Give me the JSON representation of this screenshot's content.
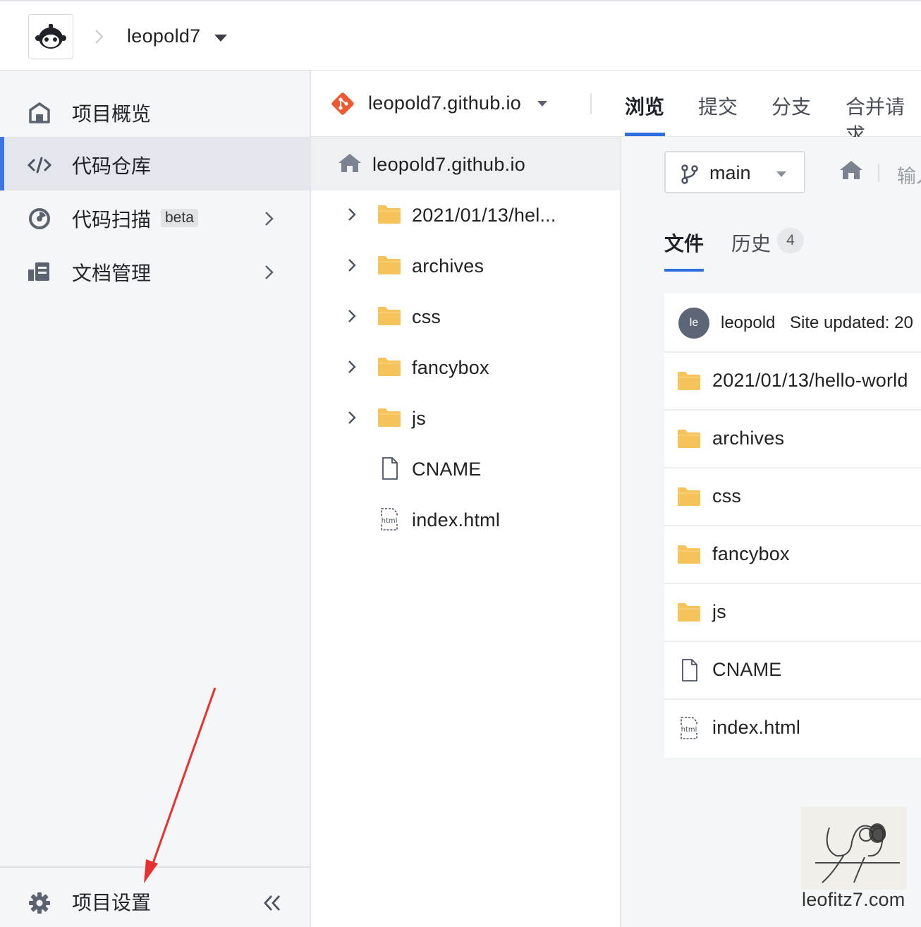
{
  "topbar": {
    "project_name": "leopold7"
  },
  "sidebar": {
    "items": [
      {
        "label": "项目概览",
        "icon": "home-icon"
      },
      {
        "label": "代码仓库",
        "icon": "code-icon"
      },
      {
        "label": "代码扫描",
        "icon": "scan-icon",
        "badge": "beta"
      },
      {
        "label": "文档管理",
        "icon": "document-icon"
      }
    ],
    "settings_label": "项目设置"
  },
  "repo_header": {
    "repo_name": "leopold7.github.io",
    "tabs": [
      "浏览",
      "提交",
      "分支",
      "合并请求"
    ],
    "active_tab": "浏览"
  },
  "tree": {
    "root": "leopold7.github.io",
    "items": [
      {
        "name": "2021/01/13/hel...",
        "type": "folder"
      },
      {
        "name": "archives",
        "type": "folder"
      },
      {
        "name": "css",
        "type": "folder"
      },
      {
        "name": "fancybox",
        "type": "folder"
      },
      {
        "name": "js",
        "type": "folder"
      },
      {
        "name": "CNAME",
        "type": "file"
      },
      {
        "name": "index.html",
        "type": "html"
      }
    ]
  },
  "main": {
    "branch": "main",
    "path_placeholder": "输入",
    "tabs": [
      "文件",
      "历史"
    ],
    "history_count": "4",
    "commit": {
      "avatar_text": "le",
      "author": "leopold",
      "message": "Site updated: 20"
    },
    "files": [
      {
        "name": "2021/01/13/hello-world",
        "type": "folder"
      },
      {
        "name": "archives",
        "type": "folder"
      },
      {
        "name": "css",
        "type": "folder"
      },
      {
        "name": "fancybox",
        "type": "folder"
      },
      {
        "name": "js",
        "type": "folder"
      },
      {
        "name": "CNAME",
        "type": "file"
      },
      {
        "name": "index.html",
        "type": "html"
      }
    ]
  },
  "watermark": {
    "text": "leofitz7.com"
  },
  "colors": {
    "accent": "#2d6fe0",
    "folder": "#f6c25a",
    "git": "#f0582f",
    "annotation_arrow": "#e8312f"
  }
}
